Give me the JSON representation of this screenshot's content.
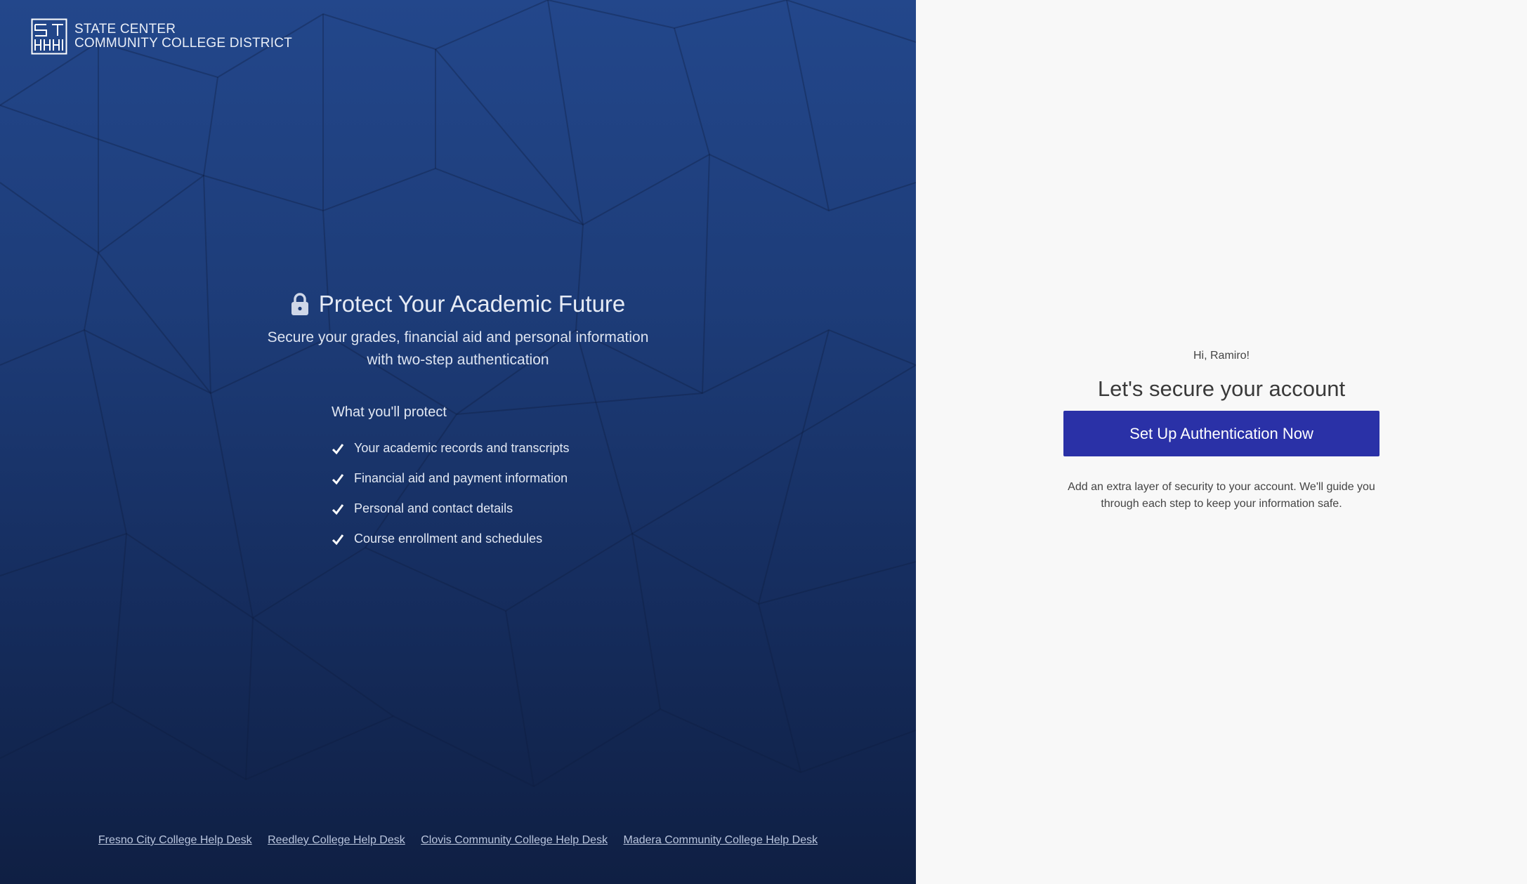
{
  "brand": {
    "line1": "STATE CENTER",
    "line2": "COMMUNITY COLLEGE DISTRICT"
  },
  "hero": {
    "title": "Protect Your Academic Future",
    "subtitle_line1": "Secure your grades, financial aid and personal information",
    "subtitle_line2": "with two-step authentication",
    "icon": "lock-icon"
  },
  "protect": {
    "heading": "What you'll protect",
    "items": [
      "Your academic records and transcripts",
      "Financial aid and payment information",
      "Personal and contact details",
      "Course enrollment and schedules"
    ],
    "icon": "check-icon"
  },
  "footer": {
    "links": [
      "Fresno City College Help Desk",
      "Reedley College Help Desk",
      "Clovis Community College Help Desk",
      "Madera Community College Help Desk"
    ]
  },
  "account": {
    "greeting": "Hi, Ramiro!",
    "headline": "Let's secure your account",
    "cta_label": "Set Up Authentication Now",
    "note": "Add an extra layer of security to your account. We'll guide you through each step to keep your information safe."
  },
  "colors": {
    "left_panel_top": "#23478b",
    "left_panel_bottom": "#0f1f43",
    "right_panel": "#f8f8f8",
    "cta": "#2a31a7"
  }
}
